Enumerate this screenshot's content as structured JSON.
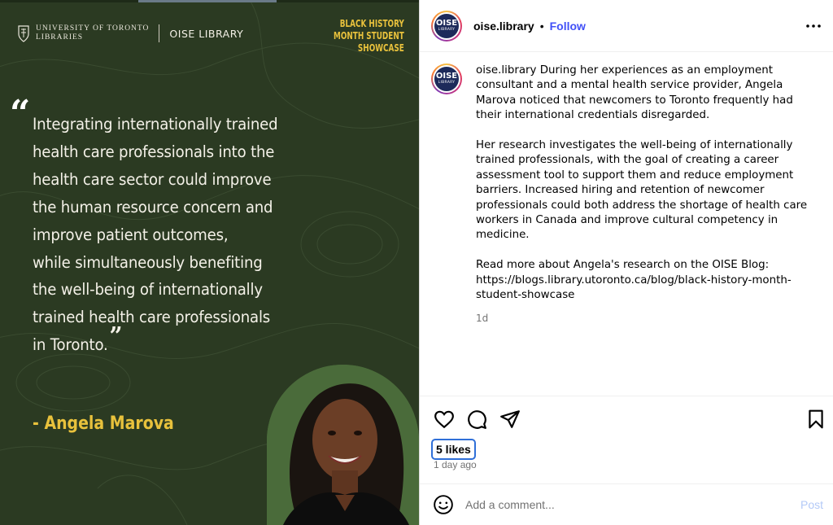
{
  "image": {
    "logo_university": "UNIVERSITY OF TORONTO",
    "logo_libraries": "LIBRARIES",
    "logo_oise": "OISE LIBRARY",
    "badge_line1": "BLACK HISTORY",
    "badge_line2": "MONTH STUDENT",
    "badge_line3": "SHOWCASE",
    "quote_open": "“",
    "quote_lines": [
      "Integrating internationally trained",
      "health care professionals into the",
      "health care sector could improve",
      "the human resource concern and",
      "improve patient outcomes,",
      "while simultaneously benefiting",
      "the well-being of internationally",
      "trained health care professionals",
      "in Toronto."
    ],
    "quote_close": "”",
    "attribution": "- Angela Marova"
  },
  "header": {
    "avatar_line1": "OISE",
    "avatar_line2": "LIBRARY",
    "username": "oise.library",
    "dot": "•",
    "follow": "Follow",
    "more_icon": "more-horizontal-icon"
  },
  "caption": {
    "username": "oise.library",
    "para1": "During her experiences as an employment consultant and a mental health service provider, Angela Marova noticed that newcomers to Toronto frequently had their international credentials disregarded.",
    "para2": "Her research investigates the well-being of internationally trained professionals, with the goal of creating a career assessment tool to support them and reduce employment barriers. Increased hiring and retention of newcomer professionals could both address the shortage of health care workers in Canada and improve cultural competency in medicine.",
    "para3": "Read more about Angela's research on the OISE Blog: https://blogs.library.utoronto.ca/blog/black-history-month-student-showcase",
    "ago": "1d"
  },
  "actions": {
    "likes": "5 likes",
    "time": "1 day ago"
  },
  "comment": {
    "placeholder": "Add a comment...",
    "post": "Post"
  },
  "colors": {
    "image_bg": "#2b3a22",
    "accent_yellow": "#e8c13c",
    "follow_blue": "#4150f7",
    "post_disabled": "#b3c9f7"
  }
}
